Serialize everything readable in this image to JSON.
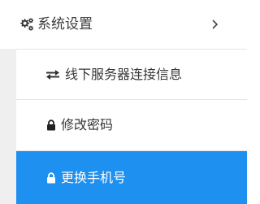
{
  "menu": {
    "header": {
      "icon": "gear-icon",
      "label": "系统设置",
      "chevron_icon": "chevron-right-icon"
    },
    "items": [
      {
        "icon": "exchange-arrows-icon",
        "label": "线下服务器连接信息",
        "active": false
      },
      {
        "icon": "lock-icon",
        "label": "修改密码",
        "active": false
      },
      {
        "icon": "lock-icon",
        "label": "更换手机号",
        "active": true
      }
    ]
  },
  "colors": {
    "active_background": "#1e90f0",
    "active_text": "#ffffff",
    "text": "#363636",
    "submenu_gutter": "#efefef"
  }
}
